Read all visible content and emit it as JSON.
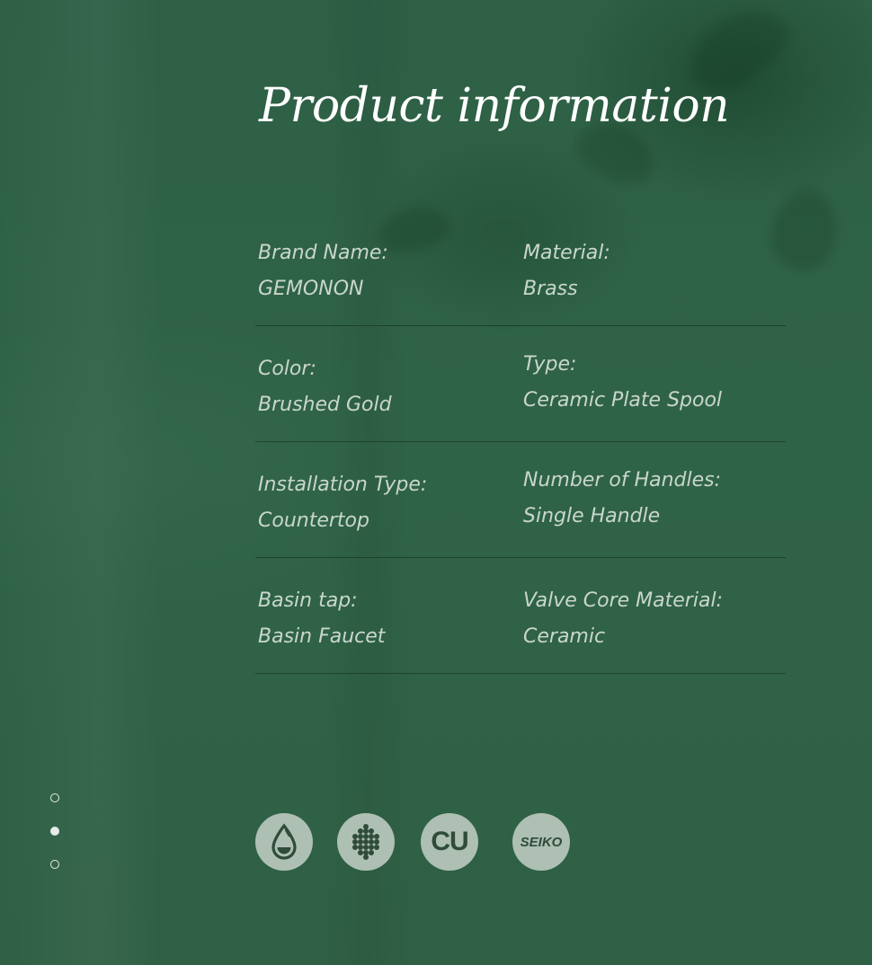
{
  "page": {
    "title": "Product information"
  },
  "specs": [
    {
      "left": {
        "label": "Brand Name:",
        "value": "GEMONON"
      },
      "right": {
        "label": "Material:",
        "value": "Brass"
      }
    },
    {
      "left": {
        "label": "Color:",
        "value": "Brushed Gold"
      },
      "right": {
        "label": "Type:",
        "value": "Ceramic Plate Spool"
      }
    },
    {
      "left": {
        "label": "Installation Type:",
        "value": "Countertop"
      },
      "right": {
        "label": "Number of Handles:",
        "value": "Single Handle"
      }
    },
    {
      "left": {
        "label": "Basin tap:",
        "value": "Basin Faucet"
      },
      "right": {
        "label": "Valve Core Material:",
        "value": "Ceramic"
      }
    }
  ],
  "pager": {
    "count": 3,
    "active_index": 1
  },
  "badges": [
    {
      "icon": "water-drop-icon"
    },
    {
      "icon": "honeycomb-filter-icon"
    },
    {
      "icon": "copper-icon",
      "text": "CU"
    },
    {
      "icon": "seiko-icon",
      "text": "SEIKO"
    }
  ],
  "colors": {
    "background": "#2f5f45",
    "text": "#c9d6cd",
    "title": "#ffffff",
    "badge": "#aebfb4",
    "badge_ink": "#2f4b3a"
  }
}
